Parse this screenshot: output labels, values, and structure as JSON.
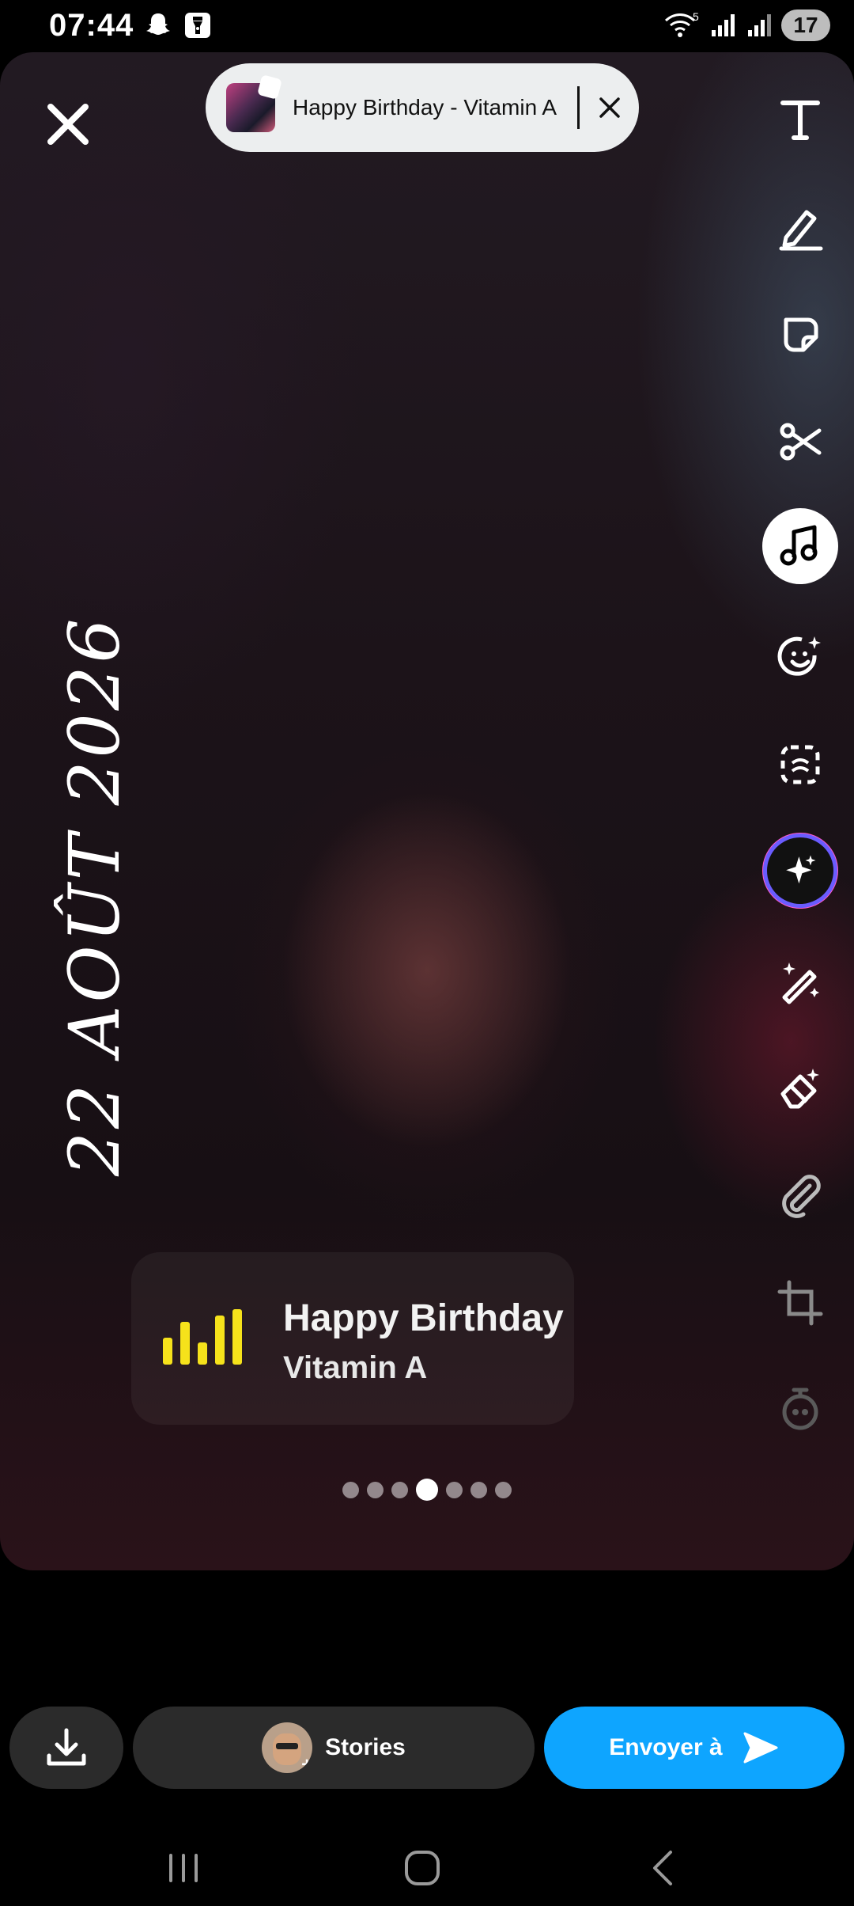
{
  "status_bar": {
    "time": "07:44",
    "left_icons": [
      "snapchat-ghost-icon",
      "flashlight-icon"
    ],
    "right_icons": [
      "wifi-icon",
      "signal-icon",
      "signal-icon"
    ],
    "wifi_badge": "5",
    "battery": "17"
  },
  "top": {
    "close_icon": "close-icon",
    "song_pill": {
      "title": "Happy Birthday - Vitamin A",
      "close_icon": "close-icon"
    }
  },
  "toolbar": {
    "tools": [
      {
        "name": "text-tool",
        "icon": "text-icon"
      },
      {
        "name": "draw-tool",
        "icon": "pencil-icon"
      },
      {
        "name": "sticker-tool",
        "icon": "sticker-icon"
      },
      {
        "name": "scissors-tool",
        "icon": "scissors-icon"
      },
      {
        "name": "music-tool",
        "icon": "music-note-icon",
        "active": true
      },
      {
        "name": "lens-tool",
        "icon": "smiley-sparkle-icon"
      },
      {
        "name": "scan-tool",
        "icon": "scan-frame-icon"
      },
      {
        "name": "ai-tool",
        "icon": "sparkles-icon"
      },
      {
        "name": "magic-wand-tool",
        "icon": "magic-wand-icon"
      },
      {
        "name": "eraser-tool",
        "icon": "eraser-icon"
      },
      {
        "name": "attachment-tool",
        "icon": "paperclip-icon"
      },
      {
        "name": "crop-tool",
        "icon": "crop-icon"
      },
      {
        "name": "timer-tool",
        "icon": "timer-icon"
      }
    ]
  },
  "date_stamp": "22 AOÛT 2026",
  "music_card": {
    "title": "Happy Birthday",
    "artist": "Vitamin A",
    "accent_color": "#f6e21b"
  },
  "pagination": {
    "count": 7,
    "active_index": 3
  },
  "bottom_bar": {
    "download_icon": "download-icon",
    "stories_label": "Stories",
    "send_label": "Envoyer à",
    "send_color": "#0ea5ff"
  },
  "nav_bar": {
    "buttons": [
      "recent-apps-icon",
      "home-icon",
      "back-icon"
    ]
  }
}
